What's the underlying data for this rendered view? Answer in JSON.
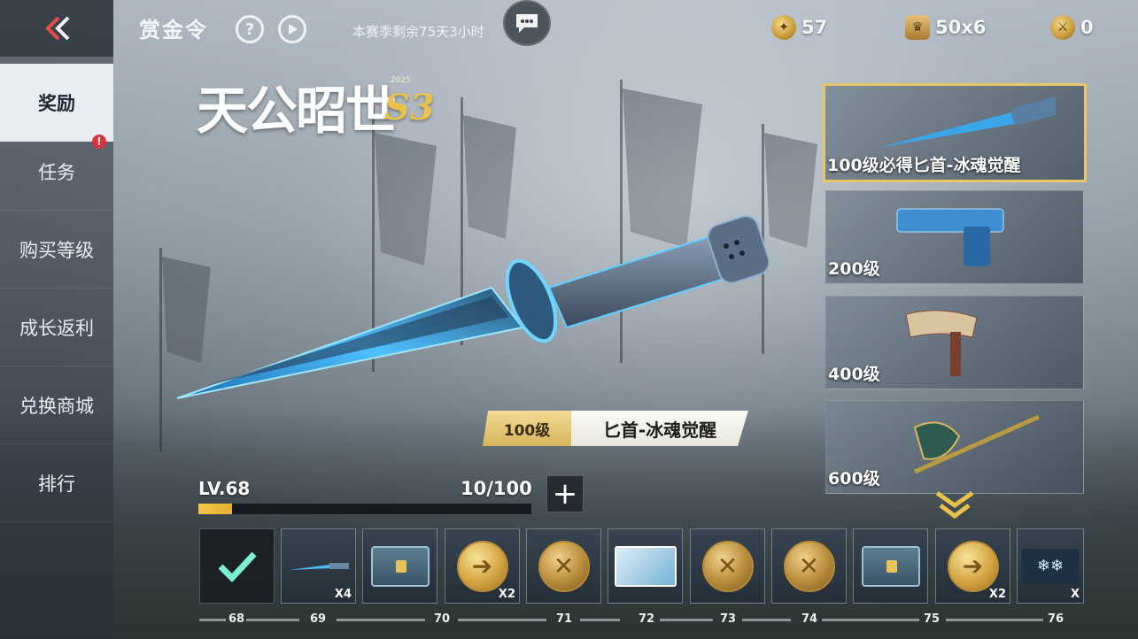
{
  "header": {
    "title": "赏金令",
    "season_remaining": "本赛季剩余75天3小时",
    "currencies": [
      {
        "icon": "gold-coin-icon",
        "value": "57"
      },
      {
        "icon": "badge-icon",
        "value": "50x6"
      },
      {
        "icon": "token-icon",
        "value": "0"
      }
    ]
  },
  "sidebar": {
    "items": [
      {
        "label": "奖励",
        "active": true
      },
      {
        "label": "任务",
        "alert": "!"
      },
      {
        "label": "购买等级"
      },
      {
        "label": "成长返利"
      },
      {
        "label": "兑换商城"
      },
      {
        "label": "排行"
      }
    ]
  },
  "featured": {
    "level": "100级",
    "name": "匕首-冰魂觉醒"
  },
  "progress": {
    "level_label": "LV.68",
    "xp": "10/100",
    "xp_fraction": 0.1
  },
  "reward_cards": [
    {
      "label": "100级必得匕首-冰魂觉醒",
      "selected": true
    },
    {
      "label": "200级"
    },
    {
      "label": "400级"
    },
    {
      "label": "600级"
    }
  ],
  "track": {
    "tiles": [
      {
        "type": "claimed",
        "qty": ""
      },
      {
        "type": "dagger",
        "qty": "X4"
      },
      {
        "type": "crate",
        "qty": ""
      },
      {
        "type": "coin",
        "qty": "X2"
      },
      {
        "type": "coin-dark",
        "qty": ""
      },
      {
        "type": "card",
        "qty": ""
      },
      {
        "type": "coin-dark",
        "qty": ""
      },
      {
        "type": "coin-dark",
        "qty": ""
      },
      {
        "type": "crate",
        "qty": ""
      },
      {
        "type": "coin",
        "qty": "X2"
      },
      {
        "type": "snow",
        "qty": "X"
      }
    ],
    "levels": [
      "68",
      "69",
      "70",
      "71",
      "72",
      "73",
      "74",
      "75",
      "76"
    ]
  },
  "colors": {
    "accent_gold": "#e8c56a",
    "xp_fill": "#f0c64a",
    "alert_red": "#e0323a",
    "active_tab_bg": "#e9edf1"
  }
}
